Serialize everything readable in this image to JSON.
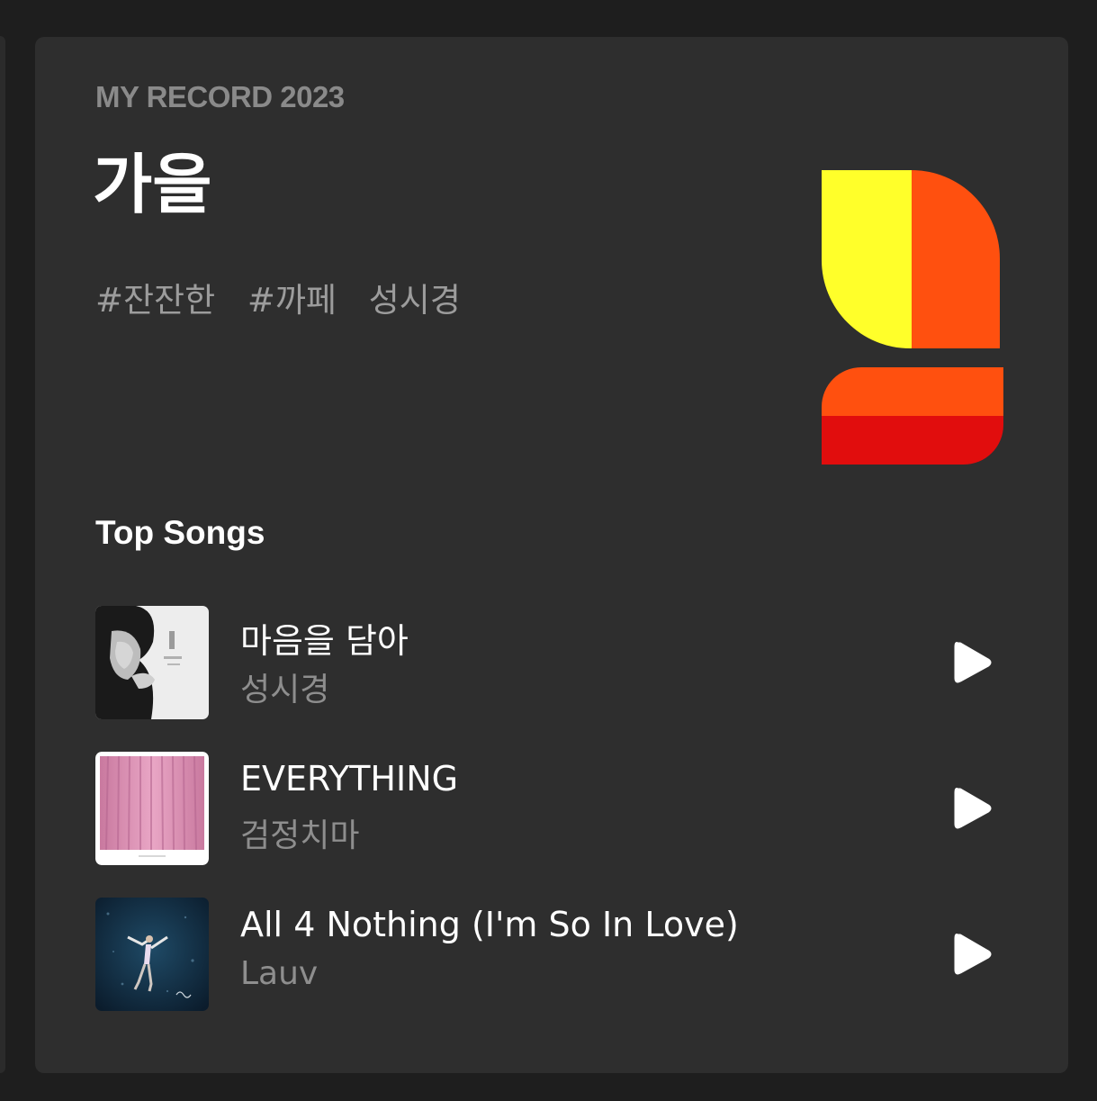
{
  "record": {
    "eyebrow": "MY RECORD 2023",
    "season": "가을",
    "tags": [
      "#잔잔한",
      "#까페",
      "성시경"
    ],
    "logo_colors": {
      "yellow": "#ffff2a",
      "orange": "#ff500f",
      "red": "#e10d0d"
    }
  },
  "top_songs": {
    "title": "Top Songs",
    "items": [
      {
        "title": "마음을 담아",
        "artist": "성시경",
        "cover_icon": "album-cover-portrait"
      },
      {
        "title": "EVERYTHING",
        "artist": "검정치마",
        "cover_icon": "album-cover-pink-curtain"
      },
      {
        "title": "All 4 Nothing (I'm So In Love)",
        "artist": "Lauv",
        "cover_icon": "album-cover-floating-figure"
      }
    ]
  },
  "icons": {
    "play": "play-icon"
  }
}
